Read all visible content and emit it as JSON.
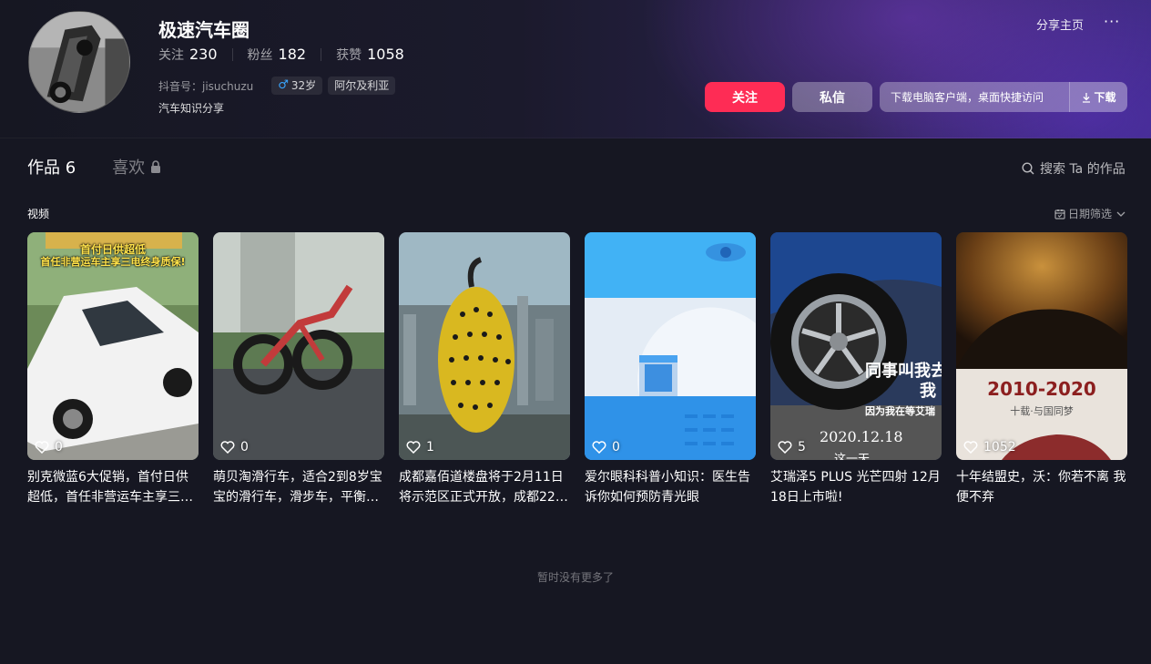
{
  "profile": {
    "username": "极速汽车圈",
    "stats": [
      {
        "label": "关注",
        "value": "230"
      },
      {
        "label": "粉丝",
        "value": "182"
      },
      {
        "label": "获赞",
        "value": "1058"
      }
    ],
    "douyin_id": "抖音号：jisuchuzu",
    "age_tag": "32岁",
    "location_tag": "阿尔及利亚",
    "signature": "汽车知识分享"
  },
  "actions": {
    "share_label": "分享主页",
    "more_label": "···",
    "follow_label": "关注",
    "message_label": "私信",
    "download_text": "下载电脑客户端，桌面快捷访问",
    "download_button": "下载"
  },
  "tabs": {
    "works_label": "作品 6",
    "likes_label": "喜欢"
  },
  "search": {
    "label": "搜索 Ta 的作品"
  },
  "section": {
    "label": "视频",
    "date_filter": "日期筛选"
  },
  "videos": [
    {
      "likes": "0",
      "title": "别克微蓝6大促销，首付日供超低，首任非营运车主享三…",
      "overlay_1": "首付日供超低",
      "overlay_2": "首任非营运车主享三电终身质保!"
    },
    {
      "likes": "0",
      "title": "萌贝淘滑行车，适合2到8岁宝宝的滑行车，滑步车，平衡…"
    },
    {
      "likes": "1",
      "title": "成都嘉佰道楼盘将于2月11日将示范区正式开放，成都22…"
    },
    {
      "likes": "0",
      "title": "爱尔眼科科普小知识：医生告诉你如何预防青光眼"
    },
    {
      "likes": "5",
      "title": "艾瑞泽5 PLUS 光芒四射 12月18日上市啦!",
      "overlay_1": "同事叫我去",
      "overlay_2": "我",
      "overlay_3": "因为我在等艾瑞",
      "overlay_date": "2020.12.18",
      "overlay_4": "这一天"
    },
    {
      "likes": "1052",
      "title": "十年结盟史，沃：你若不离 我便不弃",
      "overlay_1": "2010-2020",
      "overlay_2": "十载·与国同梦"
    }
  ],
  "footer": {
    "note": "暂时没有更多了"
  },
  "colors": {
    "accent": "#fe2c55",
    "background": "#161722"
  }
}
